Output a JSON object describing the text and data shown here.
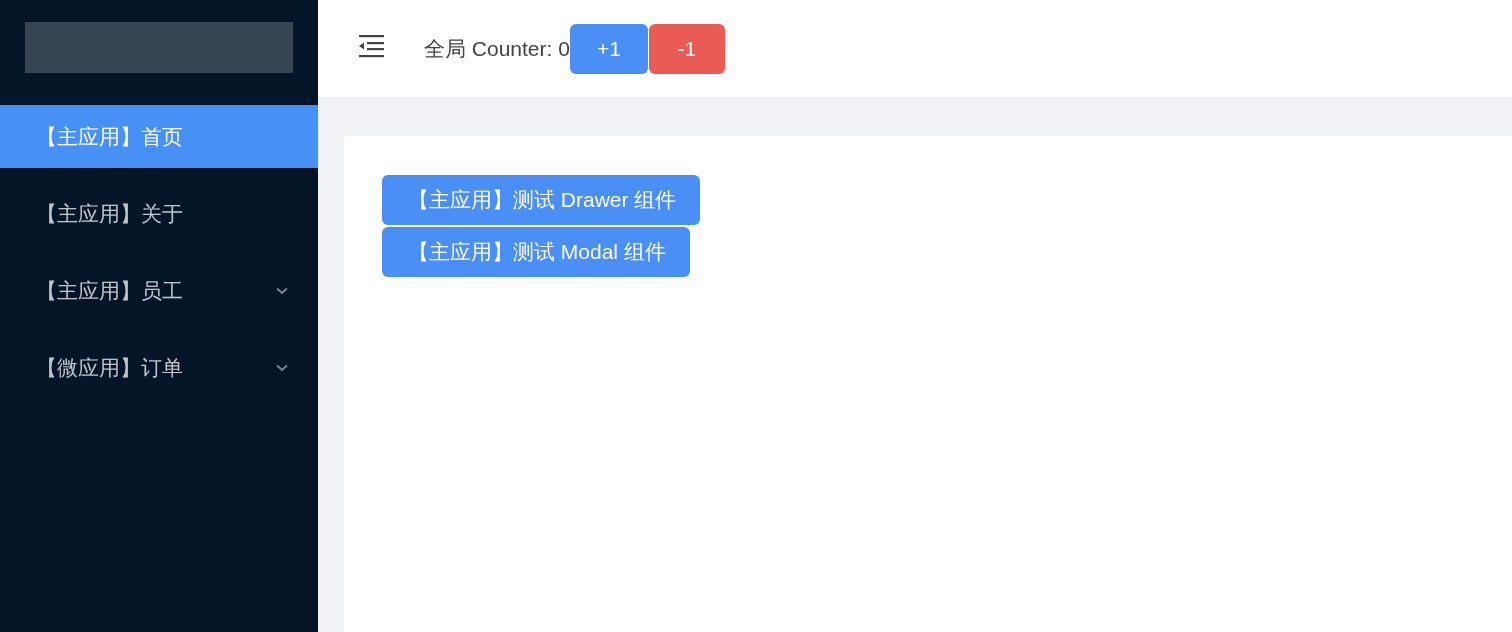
{
  "sidebar": {
    "items": [
      {
        "label": "【主应用】首页",
        "kind": "item",
        "selected": true
      },
      {
        "label": "【主应用】关于",
        "kind": "item",
        "selected": false
      },
      {
        "label": "【主应用】员工",
        "kind": "submenu",
        "selected": false
      },
      {
        "label": "【微应用】订单",
        "kind": "submenu",
        "selected": false
      }
    ]
  },
  "header": {
    "counter_label": "全局 Counter: 0",
    "buttons": [
      {
        "label": "+1",
        "kind": "primary"
      },
      {
        "label": "-1",
        "kind": "danger"
      }
    ]
  },
  "content": {
    "buttons": [
      {
        "label": "【主应用】测试 Drawer 组件"
      },
      {
        "label": "【主应用】测试 Modal 组件"
      }
    ]
  }
}
